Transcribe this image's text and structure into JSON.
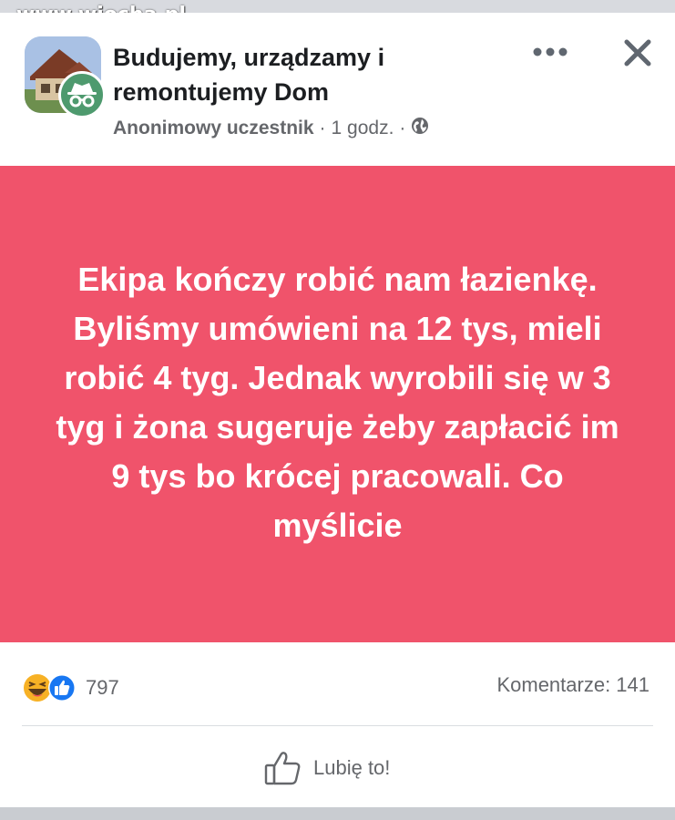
{
  "watermark": "www.wiocha.pl",
  "post": {
    "group_name": "Budujemy, urządzamy i remontujemy Dom",
    "author": "Anonimowy uczestnik",
    "time": "1 godz.",
    "separator": "·",
    "body": "Ekipa kończy robić nam łazienkę. Byliśmy umówieni na 12 tys, mieli robić 4 tyg. Jednak wyrobili się w 3 tyg i żona sugeruje żeby zapłacić im 9 tys bo krócej pracowali. Co myślicie",
    "background_color": "#f0536b"
  },
  "icons": {
    "more": "more-horizontal-icon",
    "close": "close-icon",
    "privacy": "globe-icon",
    "anon": "incognito-icon",
    "reactions": [
      "haha-reaction-icon",
      "like-reaction-icon"
    ],
    "like": "thumbs-up-icon"
  },
  "stats": {
    "reaction_count": "797",
    "comments": "Komentarze: 141"
  },
  "actions": {
    "like_label": "Lubię to!"
  },
  "colors": {
    "like_blue": "#1877f2",
    "haha_yellow": "#f7b125",
    "secondary_text": "#65676b"
  }
}
